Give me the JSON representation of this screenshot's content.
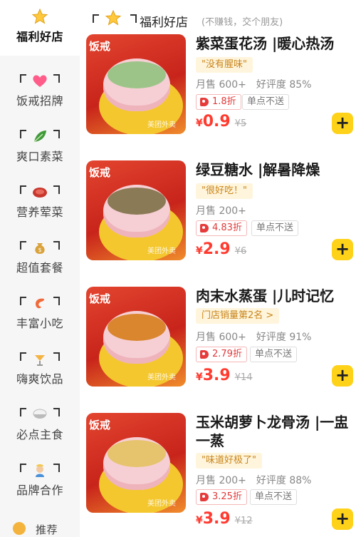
{
  "sidebar": {
    "items": [
      {
        "label": "福利好店",
        "icon": "star-icon"
      },
      {
        "label": "饭戒招牌",
        "icon": "heart-icon"
      },
      {
        "label": "爽口素菜",
        "icon": "greens-icon"
      },
      {
        "label": "营养荤菜",
        "icon": "meat-icon"
      },
      {
        "label": "超值套餐",
        "icon": "money-bag-icon"
      },
      {
        "label": "丰富小吃",
        "icon": "shrimp-icon"
      },
      {
        "label": "嗨爽饮品",
        "icon": "drink-icon"
      },
      {
        "label": "必点主食",
        "icon": "rice-bowl-icon"
      },
      {
        "label": "品牌合作",
        "icon": "chef-icon"
      },
      {
        "label": "推荐",
        "icon": "recommend-icon"
      }
    ]
  },
  "section": {
    "title": "福利好店",
    "subtitle": "(不赚钱，交个朋友)"
  },
  "products": [
    {
      "name": "紫菜蛋花汤 |暖心热汤",
      "chip": "\"没有腥味\"",
      "sales": "月售 600+",
      "rating": "好评度 85%",
      "discount": "1.8折",
      "no_single": "单点不送",
      "currency": "¥",
      "price": "0.9",
      "old_price": "¥5",
      "photo_tag": "饭戒",
      "watermark": "美团外卖",
      "soup_color": "#9cc489"
    },
    {
      "name": "绿豆糖水 |解暑降燥",
      "chip": "\"很好吃！\"",
      "sales": "月售 200+",
      "rating": "",
      "discount": "4.83折",
      "no_single": "单点不送",
      "currency": "¥",
      "price": "2.9",
      "old_price": "¥6",
      "photo_tag": "饭戒",
      "watermark": "美团外卖",
      "soup_color": "#8a7a55"
    },
    {
      "name": "肉末水蒸蛋 |儿时记忆",
      "chip": "门店销量第2名 >",
      "sales": "月售 600+",
      "rating": "好评度 91%",
      "discount": "2.79折",
      "no_single": "单点不送",
      "currency": "¥",
      "price": "3.9",
      "old_price": "¥14",
      "photo_tag": "饭戒",
      "watermark": "美团外卖",
      "soup_color": "#d9862e"
    },
    {
      "name": "玉米胡萝卜龙骨汤 |一盅一蒸",
      "chip": "\"味道好极了\"",
      "sales": "月售 200+",
      "rating": "好评度 88%",
      "discount": "3.25折",
      "no_single": "单点不送",
      "currency": "¥",
      "price": "3.9",
      "old_price": "¥12",
      "photo_tag": "饭戒",
      "watermark": "美团外卖",
      "soup_color": "#e6c36d"
    }
  ],
  "add_label": "+"
}
